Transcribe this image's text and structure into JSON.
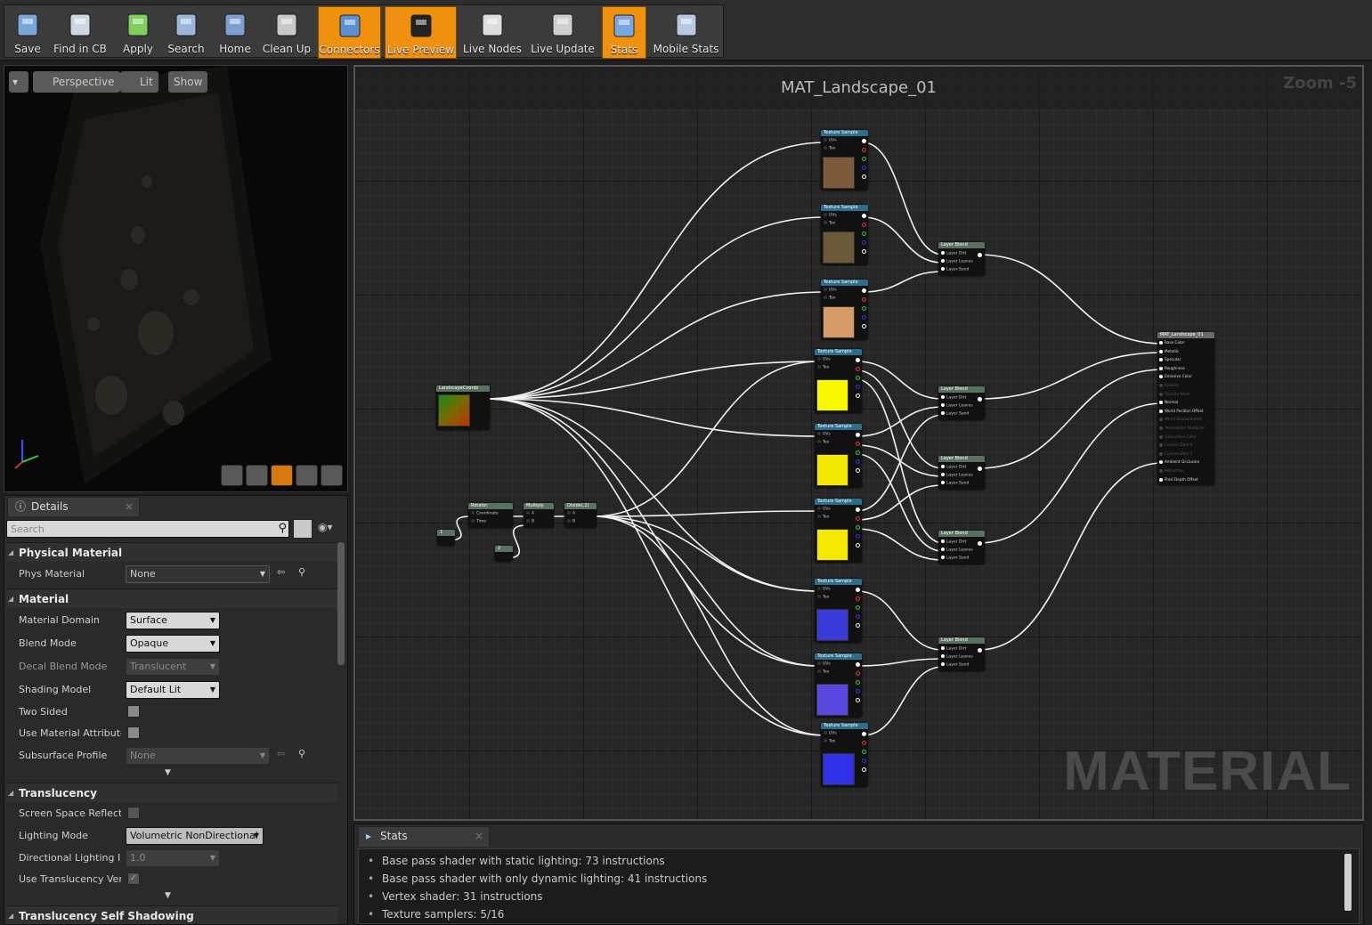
{
  "toolbar": {
    "buttons": [
      {
        "label": "Save",
        "icon": "save-icon",
        "active": false
      },
      {
        "label": "Find in CB",
        "icon": "magnifier-icon",
        "active": false
      },
      {
        "label": "Apply",
        "icon": "checkmark-icon",
        "active": false
      },
      {
        "label": "Search",
        "icon": "binoculars-icon",
        "active": false
      },
      {
        "label": "Home",
        "icon": "home-icon",
        "active": false
      },
      {
        "label": "Clean Up",
        "icon": "broom-icon",
        "active": false
      },
      {
        "label": "Connectors",
        "icon": "connectors-icon",
        "active": true
      },
      {
        "label": "Live Preview",
        "icon": "live-preview-icon",
        "active": true
      },
      {
        "label": "Live Nodes",
        "icon": "live-nodes-icon",
        "active": false
      },
      {
        "label": "Live Update",
        "icon": "live-update-icon",
        "active": false
      },
      {
        "label": "Stats",
        "icon": "stats-icon",
        "active": true
      },
      {
        "label": "Mobile Stats",
        "icon": "mobile-stats-icon",
        "active": false
      }
    ]
  },
  "viewport": {
    "perspective": "Perspective",
    "lit": "Lit",
    "show": "Show"
  },
  "details": {
    "tab": "Details",
    "search_placeholder": "Search",
    "sections": {
      "physical": "Physical Material",
      "material": "Material",
      "translucency": "Translucency",
      "self_shadow": "Translucency Self Shadowing"
    },
    "rows": {
      "phys_material": {
        "label": "Phys Material",
        "value": "None"
      },
      "material_domain": {
        "label": "Material Domain",
        "value": "Surface"
      },
      "blend_mode": {
        "label": "Blend Mode",
        "value": "Opaque"
      },
      "decal_blend": {
        "label": "Decal Blend Mode",
        "value": "Translucent"
      },
      "shading_model": {
        "label": "Shading Model",
        "value": "Default Lit"
      },
      "two_sided": {
        "label": "Two Sided"
      },
      "use_attr": {
        "label": "Use Material Attribute"
      },
      "subsurface": {
        "label": "Subsurface Profile",
        "value": "None"
      },
      "ssr": {
        "label": "Screen Space Reflecti"
      },
      "lighting_mode": {
        "label": "Lighting Mode",
        "value": "Volumetric NonDirectional"
      },
      "dir_light": {
        "label": "Directional Lighting In",
        "value": "1.0"
      },
      "use_trans": {
        "label": "Use Translucency Ver"
      }
    }
  },
  "graph": {
    "title": "MAT_Landscape_01",
    "zoom": "Zoom -5",
    "watermark": "MATERIAL",
    "nodes": {
      "texture_sample": "Texture Sample",
      "layer_blend": "Layer Blend",
      "landscape_coords": "LandscapeCoords",
      "rotator": "Rotator",
      "multiply": "Multiply",
      "divide": "Divide(,2)",
      "root": "MAT_Landscape_01",
      "const1": "1",
      "const2": "2"
    },
    "pins": {
      "uvs": "UVs",
      "tex": "Tex",
      "layer_inputs": [
        "Layer Dirt",
        "Layer Leaves",
        "Layer Sand"
      ],
      "root_inputs": [
        "Base Color",
        "Metallic",
        "Specular",
        "Roughness",
        "Emissive Color",
        "Opacity",
        "Opacity Mask",
        "Normal",
        "World Position Offset",
        "World Displacement",
        "Tessellation Multiplier",
        "Subsurface Color",
        "Custom Data 0",
        "Custom Data 1",
        "Ambient Occlusion",
        "Refraction",
        "Pixel Depth Offset"
      ],
      "rotator_inputs": [
        "Coordinate",
        "Time"
      ],
      "ab": [
        "A",
        "B"
      ]
    }
  },
  "stats": {
    "tab": "Stats",
    "lines": [
      "Base pass shader with static lighting: 73 instructions",
      "Base pass shader with only dynamic lighting: 41 instructions",
      "Vertex shader: 31 instructions",
      "Texture samplers: 5/16"
    ]
  }
}
